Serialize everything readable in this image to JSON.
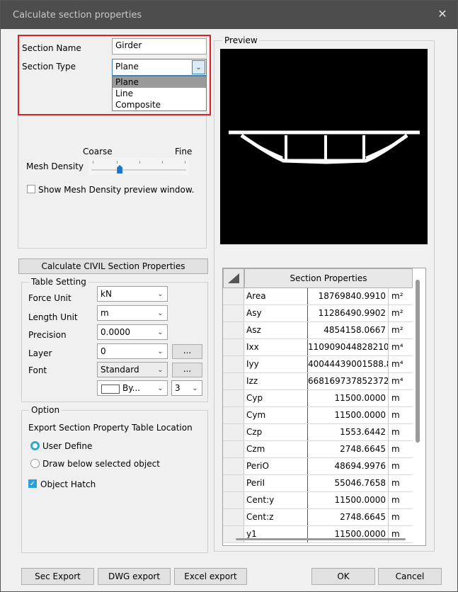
{
  "window": {
    "title": "Calculate section properties",
    "close_glyph": "✕"
  },
  "section": {
    "name_label": "Section Name",
    "name_value": "Girder",
    "type_label": "Section Type",
    "type_value": "Plane",
    "type_options": [
      "Plane",
      "Line",
      "Composite"
    ]
  },
  "mesh": {
    "coarse_label": "Coarse",
    "fine_label": "Fine",
    "density_label": "Mesh Density",
    "density_level": 0.3,
    "preview_checkbox_label": "Show Mesh Density preview window.",
    "preview_checkbox_checked": false
  },
  "calc_button": "Calculate CIVIL Section Properties",
  "table_setting": {
    "legend": "Table Setting",
    "force_unit_label": "Force Unit",
    "force_unit_value": "kN",
    "length_unit_label": "Length Unit",
    "length_unit_value": "m",
    "precision_label": "Precision",
    "precision_value": "0.0000",
    "layer_label": "Layer",
    "layer_value": "0",
    "font_label": "Font",
    "font_value": "Standard",
    "color_value": "By...",
    "size_value": "3",
    "ellipsis": "..."
  },
  "option": {
    "legend": "Option",
    "export_label": "Export Section Property Table Location",
    "user_define": "User Define",
    "draw_below": "Draw below selected object",
    "object_hatch": "Object Hatch"
  },
  "preview": {
    "legend": "Preview"
  },
  "properties": {
    "header": "Section Properties",
    "rows": [
      {
        "name": "Area",
        "value": "18769840.9910",
        "unit": "m²"
      },
      {
        "name": "Asy",
        "value": "11286490.9902",
        "unit": "m²"
      },
      {
        "name": "Asz",
        "value": "4854158.0667",
        "unit": "m²"
      },
      {
        "name": "Ixx",
        "value": "110909044828210....",
        "unit": "m⁴"
      },
      {
        "name": "Iyy",
        "value": "40044439001588.8,...",
        "unit": "m⁴"
      },
      {
        "name": "Izz",
        "value": "668169737852372....",
        "unit": "m⁴"
      },
      {
        "name": "Cyp",
        "value": "11500.0000",
        "unit": "m"
      },
      {
        "name": "Cym",
        "value": "11500.0000",
        "unit": "m"
      },
      {
        "name": "Czp",
        "value": "1553.6442",
        "unit": "m"
      },
      {
        "name": "Czm",
        "value": "2748.6645",
        "unit": "m"
      },
      {
        "name": "PeriO",
        "value": "48694.9976",
        "unit": "m"
      },
      {
        "name": "PeriI",
        "value": "55046.7658",
        "unit": "m"
      },
      {
        "name": "Cent:y",
        "value": "11500.0000",
        "unit": "m"
      },
      {
        "name": "Cent:z",
        "value": "2748.6645",
        "unit": "m"
      },
      {
        "name": "y1",
        "value": "11500.0000",
        "unit": "m"
      }
    ]
  },
  "footer": {
    "sec_export": "Sec Export",
    "dwg_export": "DWG export",
    "excel_export": "Excel export",
    "ok": "OK",
    "cancel": "Cancel"
  }
}
